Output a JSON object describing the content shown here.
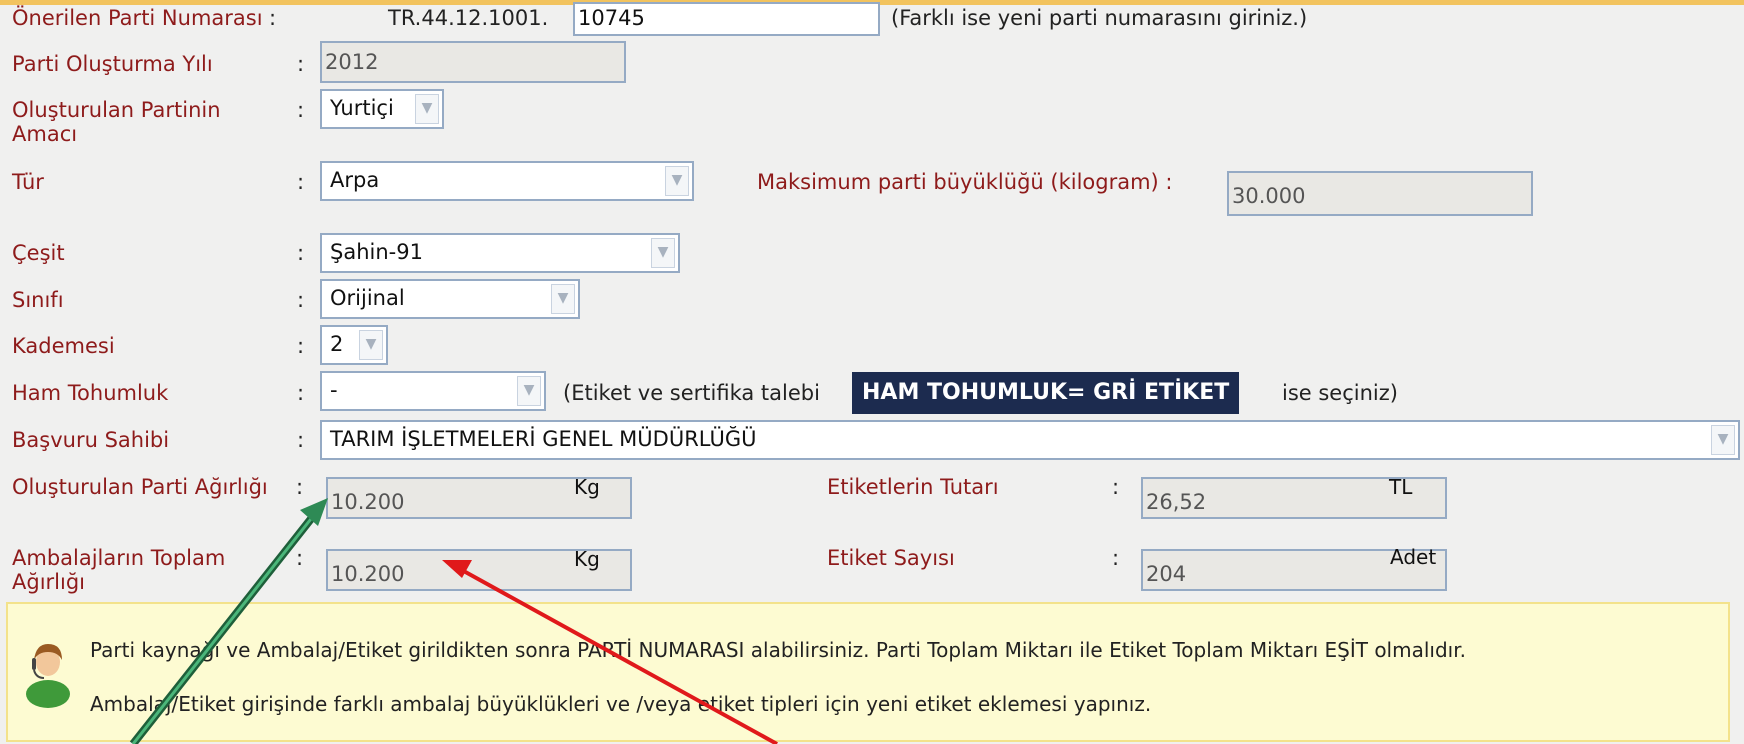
{
  "form": {
    "lot_number": {
      "label": "Önerilen Parti Numarası",
      "prefix": "TR.44.12.1001.",
      "value": "10745",
      "hint": "(Farklı ise yeni parti numarasını giriniz.)"
    },
    "year": {
      "label": "Parti Oluşturma Yılı",
      "value": "2012"
    },
    "purpose": {
      "label": "Oluşturulan Partinin Amacı",
      "selected": "Yurtiçi"
    },
    "species": {
      "label": "Tür",
      "selected": "Arpa"
    },
    "max_lot_size": {
      "label": "Maksimum parti büyüklüğü (kilogram) :",
      "value": "30.000"
    },
    "variety": {
      "label": "Çeşit",
      "selected": "Şahin-91"
    },
    "class": {
      "label": "Sınıfı",
      "selected": "Orijinal"
    },
    "stage": {
      "label": "Kademesi",
      "selected": "2"
    },
    "raw_seed": {
      "label": "Ham Tohumluk",
      "selected": "-",
      "hint_before": "(Etiket ve sertifika talebi",
      "tag": "HAM TOHUMLUK= GRİ ETİKET",
      "hint_after": "ise seçiniz)"
    },
    "applicant": {
      "label": "Başvuru Sahibi",
      "selected": "TARIM İŞLETMELERİ GENEL MÜDÜRLÜĞÜ"
    },
    "lot_weight": {
      "label": "Oluşturulan Parti Ağırlığı",
      "value": "10.200",
      "unit": "Kg"
    },
    "package_weight": {
      "label": "Ambalajların Toplam Ağırlığı",
      "value": "10.200",
      "unit": "Kg"
    },
    "label_cost": {
      "label": "Etiketlerin Tutarı",
      "value": "26,52",
      "unit": "TL"
    },
    "label_count": {
      "label": "Etiket Sayısı",
      "value": "204",
      "unit": "Adet"
    },
    "colon": ":"
  },
  "info": {
    "line1": "Parti kaynağı ve Ambalaj/Etiket girildikten sonra PARTİ NUMARASI alabilirsiniz. Parti Toplam Miktarı ile Etiket Toplam Miktarı EŞİT olmalıdır.",
    "line2": "Ambalaj/Etiket girişinde farklı ambalaj büyüklükleri ve /veya etiket tipleri için yeni etiket eklemesi yapınız."
  },
  "icons": {
    "dropdown": "chevron-down-icon",
    "info_avatar": "support-person-icon"
  },
  "colors": {
    "label": "#8e1b1b",
    "tag_bg": "#1c2b4f",
    "info_bg": "#fdfbd2",
    "green_arrow": "#2e8a55",
    "red_arrow": "#e0191b"
  }
}
